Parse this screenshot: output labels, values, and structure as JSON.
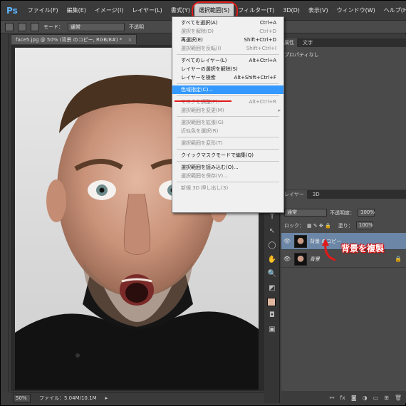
{
  "menubar": {
    "app_logo": "Ps",
    "items": [
      "ファイル(F)",
      "編集(E)",
      "イメージ(I)",
      "レイヤー(L)",
      "書式(Y)",
      "選択範囲(S)",
      "フィルター(T)",
      "3D(D)",
      "表示(V)",
      "ウィンドウ(W)",
      "ヘルプ(H)"
    ]
  },
  "options_bar": {
    "mode_label": "モード：",
    "mode_value": "通常",
    "opacity_label": "不透明"
  },
  "document": {
    "tab_title": "face5.jpg @ 50% (背景 のコピー, RGB/8#) *",
    "close": "×"
  },
  "status": {
    "zoom": "50%",
    "file_info": "ファイル：5.04M/10.1M"
  },
  "dropdown": {
    "groups": [
      [
        {
          "label": "すべてを選択(A)",
          "shortcut": "Ctrl+A",
          "disabled": false
        },
        {
          "label": "選択を解除(D)",
          "shortcut": "Ctrl+D",
          "disabled": true
        },
        {
          "label": "再選択(E)",
          "shortcut": "Shift+Ctrl+D",
          "disabled": false
        },
        {
          "label": "選択範囲を反転(I)",
          "shortcut": "Shift+Ctrl+I",
          "disabled": true
        }
      ],
      [
        {
          "label": "すべてのレイヤー(L)",
          "shortcut": "Alt+Ctrl+A",
          "disabled": false
        },
        {
          "label": "レイヤーの選択を解除(S)",
          "shortcut": "",
          "disabled": false
        },
        {
          "label": "レイヤーを検索",
          "shortcut": "Alt+Shift+Ctrl+F",
          "disabled": false
        }
      ],
      [
        {
          "label": "色域指定(C)...",
          "shortcut": "",
          "disabled": false,
          "highlight": true
        }
      ],
      [
        {
          "label": "マスクを調整(F)...",
          "shortcut": "Alt+Ctrl+R",
          "disabled": true
        },
        {
          "label": "選択範囲を変更(M)",
          "shortcut": "",
          "disabled": true,
          "submenu": true
        }
      ],
      [
        {
          "label": "選択範囲を拡張(G)",
          "shortcut": "",
          "disabled": true
        },
        {
          "label": "近似色を選択(R)",
          "shortcut": "",
          "disabled": true
        }
      ],
      [
        {
          "label": "選択範囲を変形(T)",
          "shortcut": "",
          "disabled": true
        }
      ],
      [
        {
          "label": "クイックマスクモードで編集(Q)",
          "shortcut": "",
          "disabled": false
        }
      ],
      [
        {
          "label": "選択範囲を読み込む(O)...",
          "shortcut": "",
          "disabled": false
        },
        {
          "label": "選択範囲を保存(V)...",
          "shortcut": "",
          "disabled": true
        }
      ],
      [
        {
          "label": "新規 3D 押し出し(3)",
          "shortcut": "",
          "disabled": true
        }
      ]
    ],
    "submenu_arrow": "▸"
  },
  "properties_panel": {
    "tabs": [
      "属性",
      "文字"
    ],
    "empty_text": "プロパティなし"
  },
  "layers_panel": {
    "tabs": [
      "レイヤー",
      "3D"
    ],
    "blend_mode": "通常",
    "opacity_label": "不透明度：",
    "opacity_value": "100%",
    "lock_label": "ロック：",
    "fill_label": "塗り：",
    "fill_value": "100%",
    "layers": [
      {
        "name": "背景 のコピー",
        "selected": true
      },
      {
        "name": "背景",
        "selected": false
      }
    ],
    "eye_icon": "👁"
  },
  "annotation": {
    "text": "背景を複製",
    "color": "#e01a1a"
  },
  "colors": {
    "menu_highlight": "#3399ff",
    "layer_selected": "#6b86a6",
    "annotation_red": "#e01a1a"
  }
}
